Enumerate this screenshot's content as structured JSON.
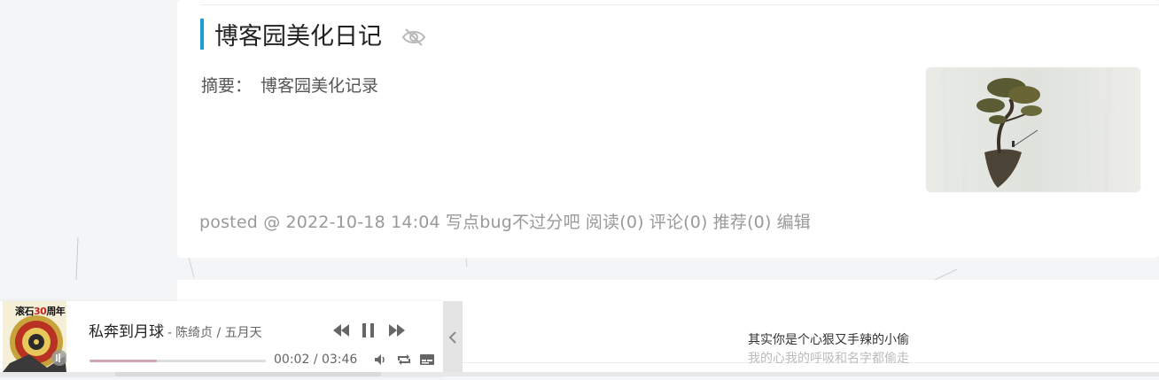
{
  "post": {
    "title": "博客园美化日记",
    "summary_label": "摘要：",
    "summary_text": "博客园美化记录",
    "meta": {
      "prefix": "posted @",
      "datetime": "2022-10-18 14:04",
      "author": "写点bug不过分吧",
      "read": "阅读(0)",
      "comments": "评论(0)",
      "recommend": "推荐(0)",
      "edit": "编辑"
    }
  },
  "player": {
    "cover_text_a": "滚石",
    "cover_text_b": "30",
    "cover_text_c": "周年",
    "song_name": "私奔到月球",
    "separator": "-",
    "artist": "陈绮贞 / 五月天",
    "current_time": "00:02",
    "time_separator": "/",
    "total_time": "03:46",
    "progress": 0.38
  },
  "lyrics": {
    "current": "其实你是个心狠又手辣的小偷",
    "next": "我的心我的呼吸和名字都偷走"
  },
  "icons": {
    "eye_slash": "eye-slash-icon",
    "prev": "skip-back-icon",
    "pause": "pause-icon",
    "next": "skip-forward-icon",
    "volume": "volume-icon",
    "loop": "loop-icon",
    "lyrics": "lyrics-icon",
    "collapse": "chevron-left-icon"
  },
  "colors": {
    "accent": "#1b9fd6",
    "progress_fill": "#d0a7b2",
    "meta_text": "#999999"
  }
}
